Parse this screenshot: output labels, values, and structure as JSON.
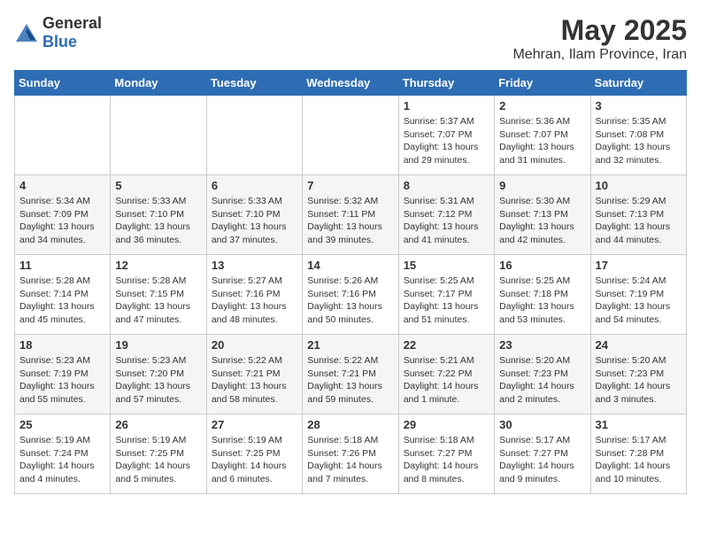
{
  "header": {
    "logo_general": "General",
    "logo_blue": "Blue",
    "title": "May 2025",
    "subtitle": "Mehran, Ilam Province, Iran"
  },
  "weekdays": [
    "Sunday",
    "Monday",
    "Tuesday",
    "Wednesday",
    "Thursday",
    "Friday",
    "Saturday"
  ],
  "weeks": [
    [
      {
        "day": "",
        "info": ""
      },
      {
        "day": "",
        "info": ""
      },
      {
        "day": "",
        "info": ""
      },
      {
        "day": "",
        "info": ""
      },
      {
        "day": "1",
        "info": "Sunrise: 5:37 AM\nSunset: 7:07 PM\nDaylight: 13 hours\nand 29 minutes."
      },
      {
        "day": "2",
        "info": "Sunrise: 5:36 AM\nSunset: 7:07 PM\nDaylight: 13 hours\nand 31 minutes."
      },
      {
        "day": "3",
        "info": "Sunrise: 5:35 AM\nSunset: 7:08 PM\nDaylight: 13 hours\nand 32 minutes."
      }
    ],
    [
      {
        "day": "4",
        "info": "Sunrise: 5:34 AM\nSunset: 7:09 PM\nDaylight: 13 hours\nand 34 minutes."
      },
      {
        "day": "5",
        "info": "Sunrise: 5:33 AM\nSunset: 7:10 PM\nDaylight: 13 hours\nand 36 minutes."
      },
      {
        "day": "6",
        "info": "Sunrise: 5:33 AM\nSunset: 7:10 PM\nDaylight: 13 hours\nand 37 minutes."
      },
      {
        "day": "7",
        "info": "Sunrise: 5:32 AM\nSunset: 7:11 PM\nDaylight: 13 hours\nand 39 minutes."
      },
      {
        "day": "8",
        "info": "Sunrise: 5:31 AM\nSunset: 7:12 PM\nDaylight: 13 hours\nand 41 minutes."
      },
      {
        "day": "9",
        "info": "Sunrise: 5:30 AM\nSunset: 7:13 PM\nDaylight: 13 hours\nand 42 minutes."
      },
      {
        "day": "10",
        "info": "Sunrise: 5:29 AM\nSunset: 7:13 PM\nDaylight: 13 hours\nand 44 minutes."
      }
    ],
    [
      {
        "day": "11",
        "info": "Sunrise: 5:28 AM\nSunset: 7:14 PM\nDaylight: 13 hours\nand 45 minutes."
      },
      {
        "day": "12",
        "info": "Sunrise: 5:28 AM\nSunset: 7:15 PM\nDaylight: 13 hours\nand 47 minutes."
      },
      {
        "day": "13",
        "info": "Sunrise: 5:27 AM\nSunset: 7:16 PM\nDaylight: 13 hours\nand 48 minutes."
      },
      {
        "day": "14",
        "info": "Sunrise: 5:26 AM\nSunset: 7:16 PM\nDaylight: 13 hours\nand 50 minutes."
      },
      {
        "day": "15",
        "info": "Sunrise: 5:25 AM\nSunset: 7:17 PM\nDaylight: 13 hours\nand 51 minutes."
      },
      {
        "day": "16",
        "info": "Sunrise: 5:25 AM\nSunset: 7:18 PM\nDaylight: 13 hours\nand 53 minutes."
      },
      {
        "day": "17",
        "info": "Sunrise: 5:24 AM\nSunset: 7:19 PM\nDaylight: 13 hours\nand 54 minutes."
      }
    ],
    [
      {
        "day": "18",
        "info": "Sunrise: 5:23 AM\nSunset: 7:19 PM\nDaylight: 13 hours\nand 55 minutes."
      },
      {
        "day": "19",
        "info": "Sunrise: 5:23 AM\nSunset: 7:20 PM\nDaylight: 13 hours\nand 57 minutes."
      },
      {
        "day": "20",
        "info": "Sunrise: 5:22 AM\nSunset: 7:21 PM\nDaylight: 13 hours\nand 58 minutes."
      },
      {
        "day": "21",
        "info": "Sunrise: 5:22 AM\nSunset: 7:21 PM\nDaylight: 13 hours\nand 59 minutes."
      },
      {
        "day": "22",
        "info": "Sunrise: 5:21 AM\nSunset: 7:22 PM\nDaylight: 14 hours\nand 1 minute."
      },
      {
        "day": "23",
        "info": "Sunrise: 5:20 AM\nSunset: 7:23 PM\nDaylight: 14 hours\nand 2 minutes."
      },
      {
        "day": "24",
        "info": "Sunrise: 5:20 AM\nSunset: 7:23 PM\nDaylight: 14 hours\nand 3 minutes."
      }
    ],
    [
      {
        "day": "25",
        "info": "Sunrise: 5:19 AM\nSunset: 7:24 PM\nDaylight: 14 hours\nand 4 minutes."
      },
      {
        "day": "26",
        "info": "Sunrise: 5:19 AM\nSunset: 7:25 PM\nDaylight: 14 hours\nand 5 minutes."
      },
      {
        "day": "27",
        "info": "Sunrise: 5:19 AM\nSunset: 7:25 PM\nDaylight: 14 hours\nand 6 minutes."
      },
      {
        "day": "28",
        "info": "Sunrise: 5:18 AM\nSunset: 7:26 PM\nDaylight: 14 hours\nand 7 minutes."
      },
      {
        "day": "29",
        "info": "Sunrise: 5:18 AM\nSunset: 7:27 PM\nDaylight: 14 hours\nand 8 minutes."
      },
      {
        "day": "30",
        "info": "Sunrise: 5:17 AM\nSunset: 7:27 PM\nDaylight: 14 hours\nand 9 minutes."
      },
      {
        "day": "31",
        "info": "Sunrise: 5:17 AM\nSunset: 7:28 PM\nDaylight: 14 hours\nand 10 minutes."
      }
    ]
  ]
}
